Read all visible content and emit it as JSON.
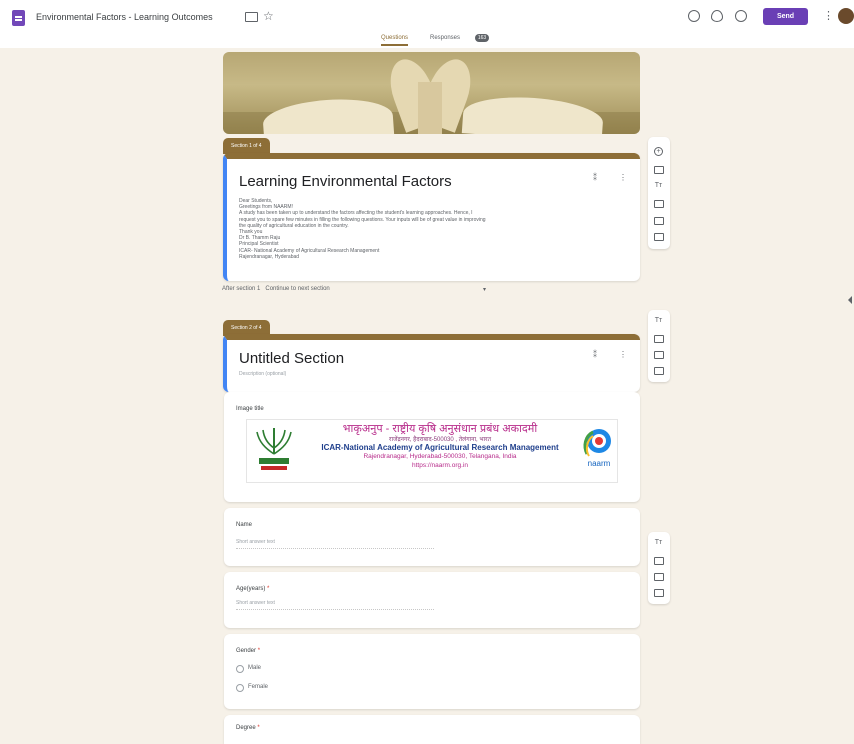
{
  "app": {
    "title": "Environmental Factors - Learning Outcomes",
    "tabs": [
      {
        "label": "Questions",
        "active": true
      },
      {
        "label": "Responses",
        "count": "163"
      }
    ],
    "send_label": "Send",
    "accent": "#8d6e37",
    "send_color": "#6a3fb5",
    "section_border": "#4285f4"
  },
  "header_image": {
    "icon": "open-book-heart-pages"
  },
  "section1": {
    "tag": "Section 1 of 4",
    "title": "Learning Environmental  Factors",
    "description": "Dear Students,\nGreetings from NAARM!\nA study has been taken up to understand the factors affecting the student's learning approaches. Hence, I\nrequest you to spare few minutes in filling the following questions. Your inputs will be of great value in improving\nthe quality of agricultural education in the country.\nThank you\nDr B. Thamm Raju\nPrincipal Scientist\nICAR- National Academy of Agricultural Research Management\nRajendranagar, Hyderabad",
    "after_section": "After section 1",
    "after_section_value": "Continue to next section"
  },
  "section2": {
    "tag": "Section 2 of 4",
    "title": "Untitled Section",
    "description_placeholder": "Description (optional)"
  },
  "image_item": {
    "title": "Image title",
    "logo": {
      "hindi_line1": "भाकृअनुप - राष्ट्रीय कृषि अनुसंधान प्रबंध अकादमी",
      "hindi_line2": "राजेंद्रनगर, हैदराबाद-500030 , तेलंगाना, भारत",
      "english_name": "ICAR-National Academy of Agricultural Research Management",
      "address": "Rajendranagar, Hyderabad-500030, Telangana, India",
      "url": "https://naarm.org.in",
      "right_logo_text": "naarm"
    }
  },
  "questions": [
    {
      "label": "Name",
      "required": false,
      "answer_placeholder": "Short answer text"
    },
    {
      "label": "Age(years)",
      "required": true,
      "answer_placeholder": "Short answer text"
    },
    {
      "label": "Gender",
      "required": true,
      "options": [
        "Male",
        "Female"
      ]
    },
    {
      "label": "Degree",
      "required": true
    }
  ],
  "toolbar_icons": {
    "add": "add-question-icon",
    "import": "import-questions-icon",
    "title": "add-title-icon",
    "image": "add-image-icon",
    "video": "add-video-icon",
    "section": "add-section-icon"
  }
}
